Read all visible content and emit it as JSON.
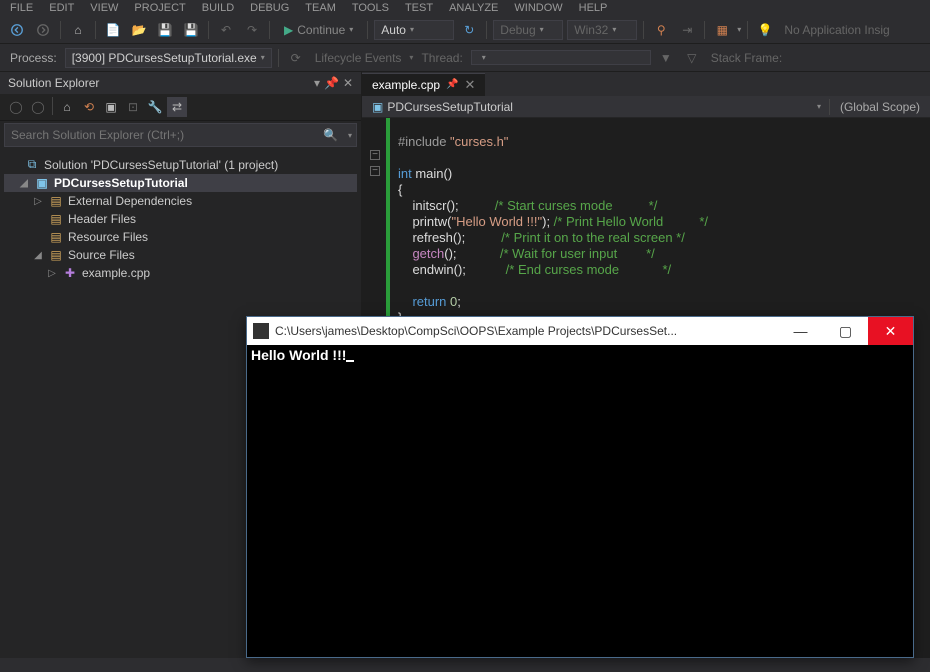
{
  "menubar": [
    "FILE",
    "EDIT",
    "VIEW",
    "PROJECT",
    "BUILD",
    "DEBUG",
    "TEAM",
    "TOOLS",
    "TEST",
    "ANALYZE",
    "WINDOW",
    "HELP"
  ],
  "toolbar": {
    "continue": "Continue",
    "config": "Auto",
    "solution_config": "Debug",
    "platform": "Win32",
    "no_app_insights": "No Application Insig"
  },
  "process_bar": {
    "label": "Process:",
    "process": "[3900] PDCursesSetupTutorial.exe",
    "lifecycle": "Lifecycle Events",
    "thread_label": "Thread:",
    "thread_value": "",
    "stack_frame": "Stack Frame:"
  },
  "solution_explorer": {
    "title": "Solution Explorer",
    "search_placeholder": "Search Solution Explorer (Ctrl+;)",
    "solution": "Solution 'PDCursesSetupTutorial' (1 project)",
    "project": "PDCursesSetupTutorial",
    "folders": {
      "external": "External Dependencies",
      "header": "Header Files",
      "resource": "Resource Files",
      "source": "Source Files"
    },
    "file": "example.cpp"
  },
  "editor": {
    "tab": "example.cpp",
    "context_project": "PDCursesSetupTutorial",
    "context_scope": "(Global Scope)",
    "code": {
      "l1a": "#include ",
      "l1b": "\"curses.h\"",
      "l3a": "int",
      "l3b": " main()",
      "l4": "{",
      "l5a": "    initscr();          ",
      "l5b": "/* Start curses mode          */",
      "l6a": "    printw(",
      "l6b": "\"Hello World !!!\"",
      "l6c": "); ",
      "l6d": "/* Print Hello World          */",
      "l7a": "    refresh();          ",
      "l7b": "/* Print it on to the real screen */",
      "l8a": "    ",
      "l8b": "getch",
      "l8c": "();            ",
      "l8d": "/* Wait for user input        */",
      "l9a": "    endwin();           ",
      "l9b": "/* End curses mode            */",
      "l11a": "    ",
      "l11b": "return",
      "l11c": " ",
      "l11d": "0",
      "l11e": ";",
      "l12": "}"
    }
  },
  "console": {
    "title": "C:\\Users\\james\\Desktop\\CompSci\\OOPS\\Example Projects\\PDCursesSet...",
    "output": "Hello World !!!"
  }
}
